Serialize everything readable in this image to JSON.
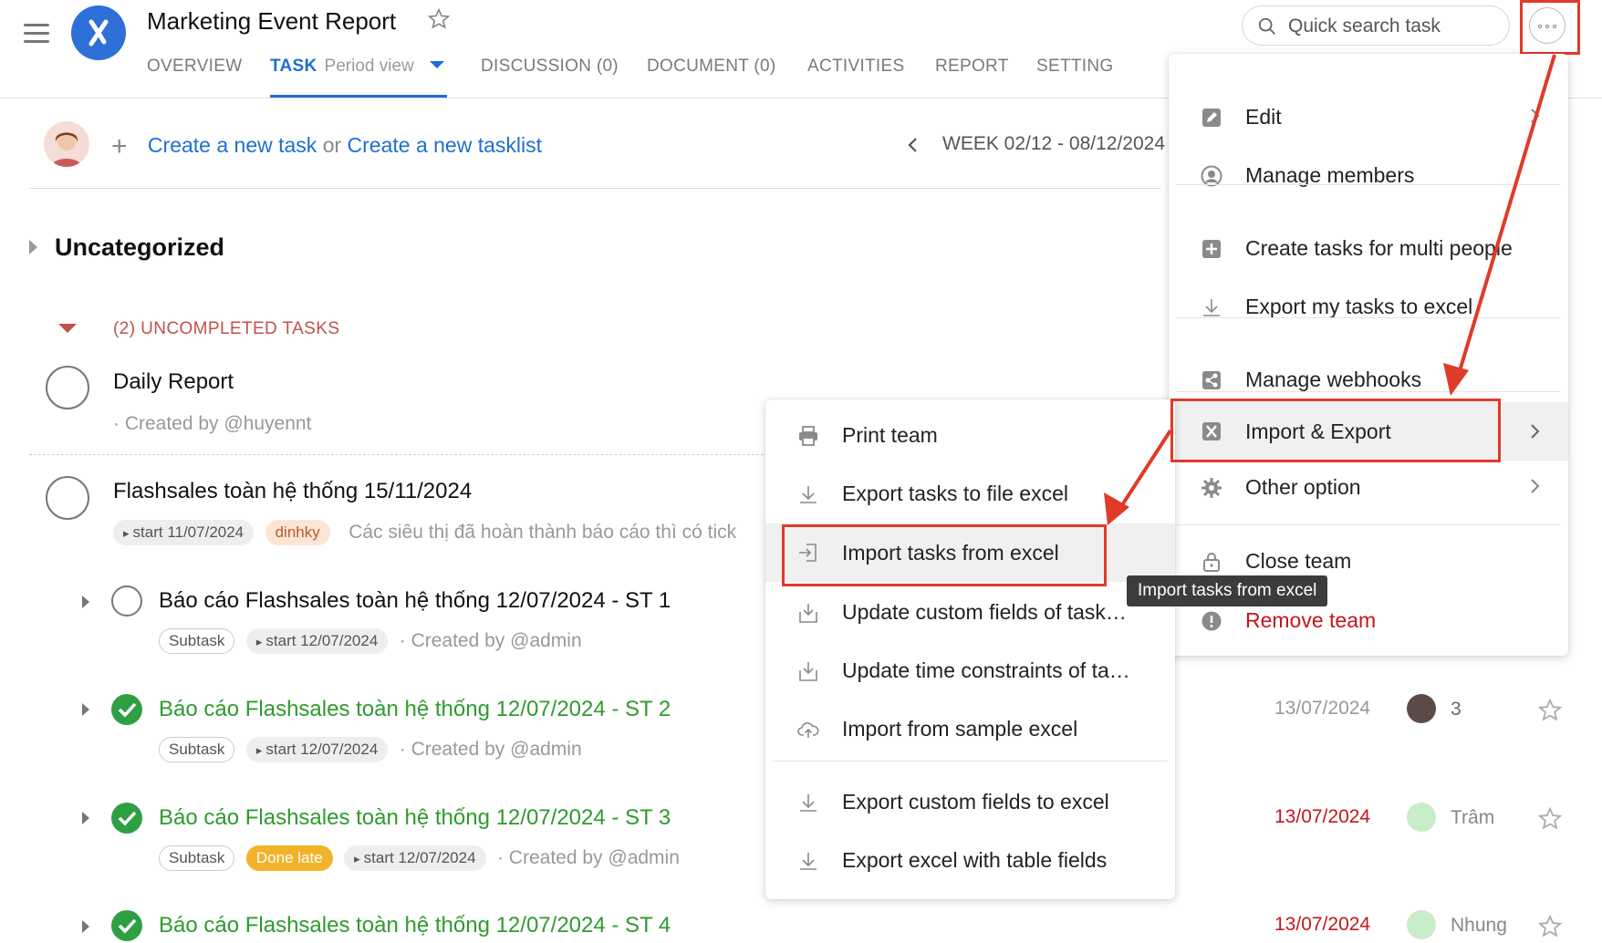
{
  "header": {
    "title": "Marketing Event Report",
    "tabs": [
      {
        "label": "OVERVIEW"
      },
      {
        "label": "TASK",
        "sub": "Period view"
      },
      {
        "label": "DISCUSSION (0)"
      },
      {
        "label": "DOCUMENT (0)"
      },
      {
        "label": "ACTIVITIES"
      },
      {
        "label": "REPORT"
      },
      {
        "label": "SETTING"
      }
    ],
    "search_placeholder": "Quick search task"
  },
  "create": {
    "task_link": "Create a new task",
    "or": "or",
    "tasklist_link": "Create a new tasklist"
  },
  "week": "WEEK 02/12 - 08/12/2024",
  "category": "Uncategorized",
  "uncompleted_label": "(2) UNCOMPLETED TASKS",
  "tasks": [
    {
      "title": "Daily Report",
      "meta": "· Created by @huyennt"
    },
    {
      "title": "Flashsales toàn hệ thống 15/11/2024",
      "start": "start 11/07/2024",
      "tag": "dinhky",
      "desc": "Các siêu thị đã hoàn thành báo cáo thì có tick"
    }
  ],
  "subtasks": [
    {
      "title": "Báo cáo Flashsales toàn hệ thống 12/07/2024 - ST 1",
      "tag": "Subtask",
      "start": "start 12/07/2024",
      "meta": "· Created by @admin",
      "done": false
    },
    {
      "title": "Báo cáo Flashsales toàn hệ thống 12/07/2024 - ST 2",
      "tag": "Subtask",
      "start": "start 12/07/2024",
      "meta": "· Created by @admin",
      "done": true,
      "date": "13/07/2024",
      "assignee": "3"
    },
    {
      "title": "Báo cáo Flashsales toàn hệ thống 12/07/2024 - ST 3",
      "tag": "Subtask",
      "status": "Done late",
      "start": "start 12/07/2024",
      "meta": "· Created by @admin",
      "done": true,
      "date": "13/07/2024",
      "assignee": "Trâm"
    },
    {
      "title": "Báo cáo Flashsales toàn hệ thống 12/07/2024 - ST 4",
      "done": true,
      "date": "13/07/2024",
      "assignee": "Nhung"
    }
  ],
  "main_menu": [
    {
      "label": "Edit",
      "icon": "pencil-icon"
    },
    {
      "label": "Manage members",
      "icon": "user-circle-icon"
    },
    {
      "label": "Create tasks for multi people",
      "icon": "plus-square-icon"
    },
    {
      "label": "Export my tasks to excel",
      "icon": "download-icon"
    },
    {
      "label": "Manage webhooks",
      "icon": "share-icon"
    },
    {
      "label": "Import & Export",
      "icon": "excel-icon"
    },
    {
      "label": "Other option",
      "icon": "gear-icon"
    },
    {
      "label": "Close team",
      "icon": "lock-icon"
    },
    {
      "label": "Remove team",
      "icon": "warning-icon"
    }
  ],
  "sub_menu": [
    {
      "label": "Print team",
      "icon": "printer-icon"
    },
    {
      "label": "Export tasks to file excel",
      "icon": "download-icon"
    },
    {
      "label": "Import tasks from excel",
      "icon": "import-icon"
    },
    {
      "label": "Update custom fields of task…",
      "icon": "download-box-icon"
    },
    {
      "label": "Update time constraints of ta…",
      "icon": "download-box-icon"
    },
    {
      "label": "Import from sample excel",
      "icon": "cloud-upload-icon"
    },
    {
      "label": "Export custom fields to excel",
      "icon": "download-icon"
    },
    {
      "label": "Export excel with table fields",
      "icon": "download-icon"
    }
  ],
  "tooltip": "Import tasks from excel",
  "colors": {
    "accent": "#1e6fd1",
    "highlight_border": "#e03a2a",
    "done_green": "#2ea043",
    "overdue_red": "#c4161c",
    "remove_red": "#c4161c"
  }
}
